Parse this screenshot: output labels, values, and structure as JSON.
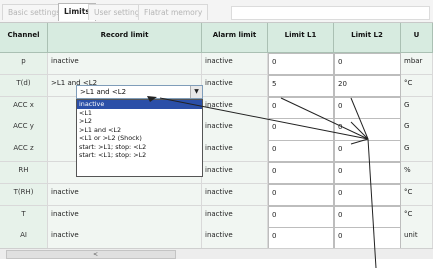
{
  "tabs": [
    {
      "label": "Basic settings",
      "active": false
    },
    {
      "label": "Limits",
      "active": true
    },
    {
      "label": "User settings",
      "active": false
    },
    {
      "label": "Flatrat memory",
      "active": false
    }
  ],
  "columns": [
    "Channel",
    "Record limit",
    "Alarm limit",
    "Limit L1",
    "Limit L2",
    "U"
  ],
  "rows": [
    {
      "channel": "p",
      "record": "inactive",
      "alarm": "inactive",
      "l1": "0",
      "l2": "0",
      "unit": "mbar"
    },
    {
      "channel": "T(d)",
      "record": ">L1 and <L2",
      "alarm": "inactive",
      "l1": "5",
      "l2": "20",
      "unit": "°C"
    },
    {
      "channel": "ACC x",
      "record": "",
      "alarm": "inactive",
      "l1": "0",
      "l2": "0",
      "unit": "G"
    },
    {
      "channel": "ACC y",
      "record": "",
      "alarm": "inactive",
      "l1": "0",
      "l2": "0",
      "unit": "G"
    },
    {
      "channel": "ACC z",
      "record": "",
      "alarm": "inactive",
      "l1": "0",
      "l2": "0",
      "unit": "G"
    },
    {
      "channel": "RH",
      "record": "",
      "alarm": "inactive",
      "l1": "0",
      "l2": "0",
      "unit": "%"
    },
    {
      "channel": "T(RH)",
      "record": "inactive",
      "alarm": "inactive",
      "l1": "0",
      "l2": "0",
      "unit": "°C"
    },
    {
      "channel": "T",
      "record": "inactive",
      "alarm": "inactive",
      "l1": "0",
      "l2": "0",
      "unit": "°C"
    },
    {
      "channel": "AI",
      "record": "inactive",
      "alarm": "inactive",
      "l1": "0",
      "l2": "0",
      "unit": "unit"
    }
  ],
  "combo": {
    "value": ">L1 and <L2",
    "button_icon": "▼"
  },
  "dropdown_options": [
    "inactive",
    "<L1",
    ">L2",
    ">L1 and <L2",
    "<L1 or >L2 (Shock)",
    "start: >L1; stop: <L2",
    "start: <L1; stop: >L2"
  ],
  "dropdown_selected_index": 0,
  "scrollbar": {
    "label": "<"
  },
  "colors": {
    "header_bg": "#d7ebe0",
    "selection": "#2b4fa8",
    "callout_line": "#222222"
  }
}
